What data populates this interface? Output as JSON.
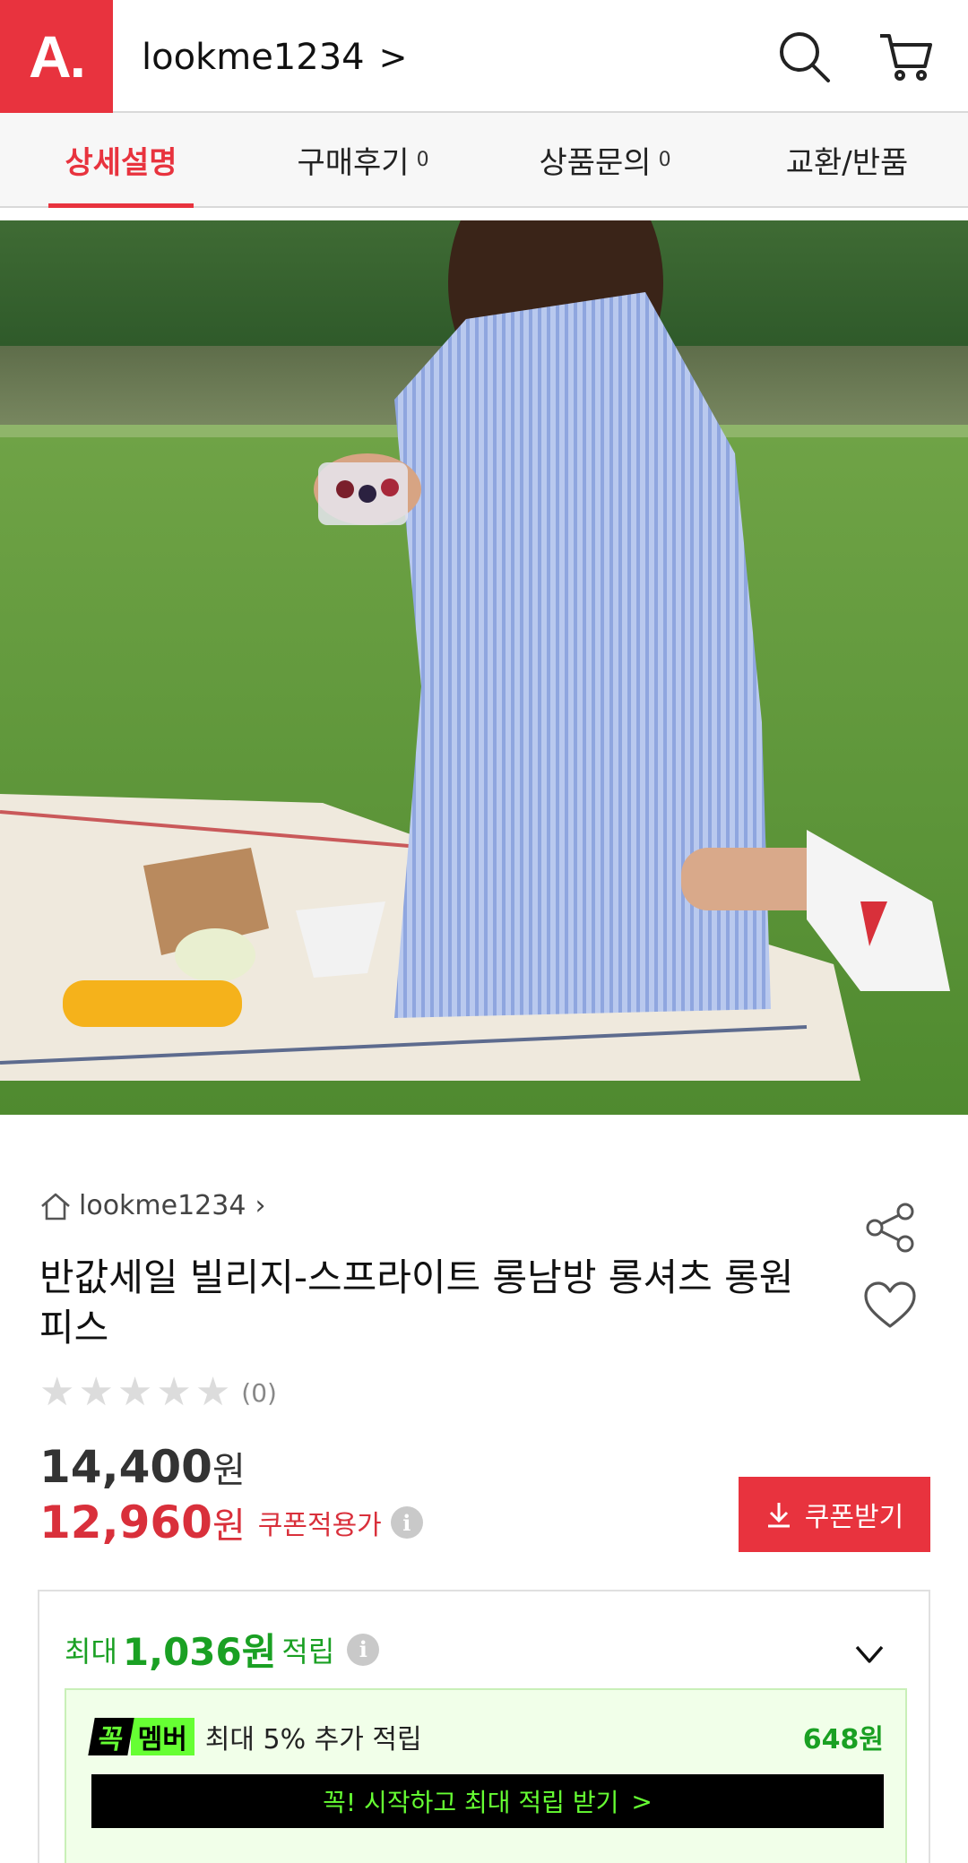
{
  "header": {
    "logo_text": "A.",
    "shop_name": "lookme1234",
    "shop_chevron": ">",
    "icons": [
      "search-icon",
      "cart-icon"
    ]
  },
  "tabs": [
    {
      "label": "상세설명",
      "count": "",
      "active": true
    },
    {
      "label": "구매후기",
      "count": "0",
      "active": false
    },
    {
      "label": "상품문의",
      "count": "0",
      "active": false
    },
    {
      "label": "교환/반품",
      "count": "",
      "active": false
    }
  ],
  "product": {
    "shop_name": "lookme1234",
    "title": "반값세일 빌리지-스프라이트 롱남방 롱셔츠 롱원피스",
    "rating_stars": 0,
    "rating_count": "(0)",
    "original_price": "14,400",
    "original_currency": "원",
    "sale_price": "12,960",
    "sale_currency": "원",
    "coupon_price_label": "쿠폰적용가",
    "coupon_button": "쿠폰받기"
  },
  "points": {
    "prefix": "최대",
    "amount": "1,036원",
    "suffix": "적립",
    "member_badge_1": "꼭",
    "member_badge_2": "멤버",
    "member_text": "최대 5% 추가 적립",
    "member_amount": "648원",
    "member_cta": "꼭! 시작하고 최대 적립 받기",
    "member_cta_chevron": ">"
  },
  "colors": {
    "brand": "#e8333e",
    "points_green": "#1aa023",
    "member_green": "#66ff33"
  }
}
